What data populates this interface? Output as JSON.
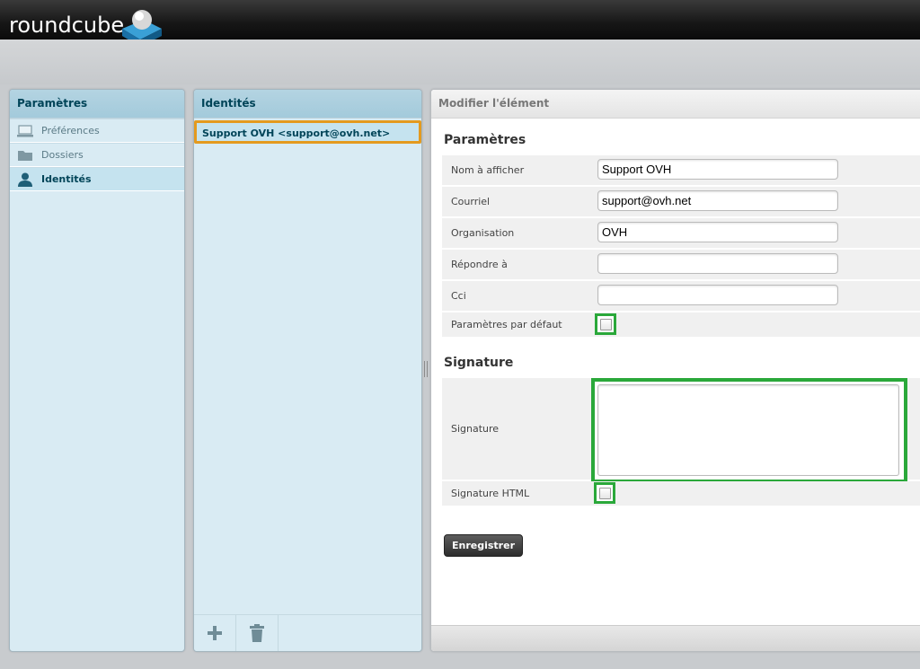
{
  "app": {
    "logo_text": "roundcube"
  },
  "settings_panel": {
    "title": "Paramètres",
    "items": [
      {
        "label": "Préférences",
        "icon": "computer-icon",
        "active": false
      },
      {
        "label": "Dossiers",
        "icon": "folder-icon",
        "active": false
      },
      {
        "label": "Identités",
        "icon": "person-icon",
        "active": true
      }
    ]
  },
  "identities_panel": {
    "title": "Identités",
    "selected_identity": "Support OVH <support@ovh.net>",
    "footer": {
      "add_icon": "plus-icon",
      "delete_icon": "trash-icon"
    }
  },
  "edit_panel": {
    "title": "Modifier l'élément",
    "section_parametres": "Paramètres",
    "fields": {
      "display_name": {
        "label": "Nom à afficher",
        "value": "Support OVH"
      },
      "email": {
        "label": "Courriel",
        "value": "support@ovh.net"
      },
      "organization": {
        "label": "Organisation",
        "value": "OVH"
      },
      "reply_to": {
        "label": "Répondre à",
        "value": ""
      },
      "bcc": {
        "label": "Cci",
        "value": ""
      },
      "default": {
        "label": "Paramètres par défaut",
        "checked": false
      }
    },
    "section_signature": "Signature",
    "signature": {
      "label": "Signature",
      "value": ""
    },
    "html_signature": {
      "label": "Signature HTML",
      "checked": false
    },
    "save_label": "Enregistrer"
  },
  "colors": {
    "highlight_selected": "#e49a1f",
    "highlight_fields": "#2aa83a",
    "panel_header": "#a3cadb"
  }
}
